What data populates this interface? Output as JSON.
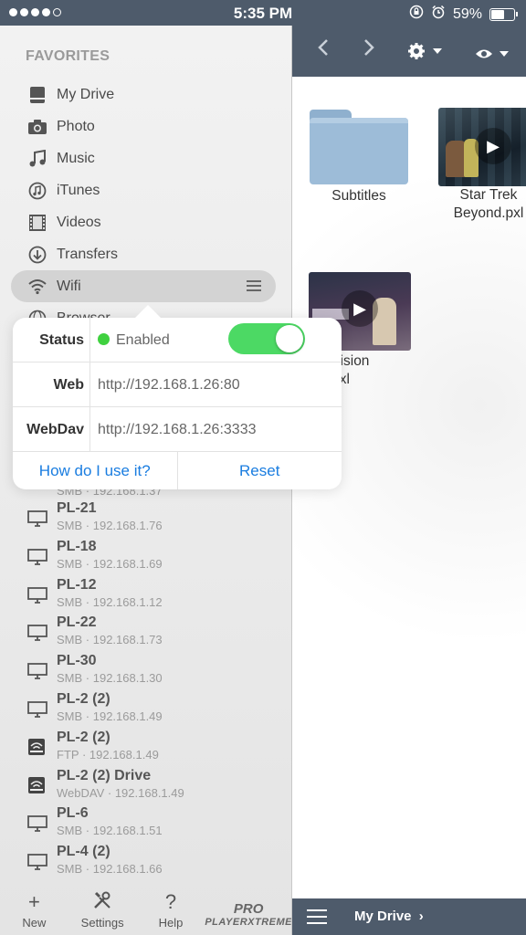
{
  "status_bar": {
    "time": "5:35 PM",
    "battery": "59%",
    "battery_level": 0.59
  },
  "sidebar": {
    "favorites_title": "FAVORITES",
    "items": [
      {
        "label": "My Drive",
        "icon": "drive-icon"
      },
      {
        "label": "Photo",
        "icon": "camera-icon"
      },
      {
        "label": "Music",
        "icon": "music-note-icon"
      },
      {
        "label": "iTunes",
        "icon": "itunes-icon"
      },
      {
        "label": "Videos",
        "icon": "film-icon"
      },
      {
        "label": "Transfers",
        "icon": "download-icon"
      },
      {
        "label": "Wifi",
        "icon": "wifi-icon"
      },
      {
        "label": "Browser",
        "icon": "globe-icon"
      }
    ],
    "servers": [
      {
        "name": "PL-21",
        "proto": "SMB",
        "addr": "192.168.1.76",
        "icon": "monitor-icon"
      },
      {
        "name": "PL-18",
        "proto": "SMB",
        "addr": "192.168.1.69",
        "icon": "monitor-icon"
      },
      {
        "name": "PL-12",
        "proto": "SMB",
        "addr": "192.168.1.12",
        "icon": "monitor-icon"
      },
      {
        "name": "PL-22",
        "proto": "SMB",
        "addr": "192.168.1.73",
        "icon": "monitor-icon"
      },
      {
        "name": "PL-30",
        "proto": "SMB",
        "addr": "192.168.1.30",
        "icon": "monitor-icon"
      },
      {
        "name": "PL-2 (2)",
        "proto": "SMB",
        "addr": "192.168.1.49",
        "icon": "monitor-icon"
      },
      {
        "name": "PL-2 (2)",
        "proto": "FTP",
        "addr": "192.168.1.49",
        "icon": "wifi-drive-icon"
      },
      {
        "name": "PL-2 (2) Drive",
        "proto": "WebDAV",
        "addr": "192.168.1.49",
        "icon": "wifi-drive-icon"
      },
      {
        "name": "PL-6",
        "proto": "SMB",
        "addr": "192.168.1.51",
        "icon": "monitor-icon"
      },
      {
        "name": "PL-4 (2)",
        "proto": "SMB",
        "addr": "192.168.1.66",
        "icon": "monitor-icon"
      }
    ],
    "partial_server_addr": "SMB · 192.168.1.37",
    "toolbar": {
      "new": "New",
      "settings": "Settings",
      "help": "Help",
      "brand_top": "PRO",
      "brand_bottom": "PLAYERXTREME"
    }
  },
  "popover": {
    "status_label": "Status",
    "status_value": "Enabled",
    "web_label": "Web",
    "web_value": "http://192.168.1.26:80",
    "webdav_label": "WebDav",
    "webdav_value": "http://192.168.1.26:3333",
    "help_link": "How do I use it?",
    "reset_button": "Reset"
  },
  "content": {
    "tiles": [
      {
        "line1": "Subtitles",
        "line2": ""
      },
      {
        "line1": "Star Trek",
        "line2": "Beyond.pxl"
      },
      {
        "line1": "ge: Collision",
        "line2": "ourse.pxl"
      }
    ]
  },
  "bottom_bar": {
    "location": "My Drive"
  }
}
